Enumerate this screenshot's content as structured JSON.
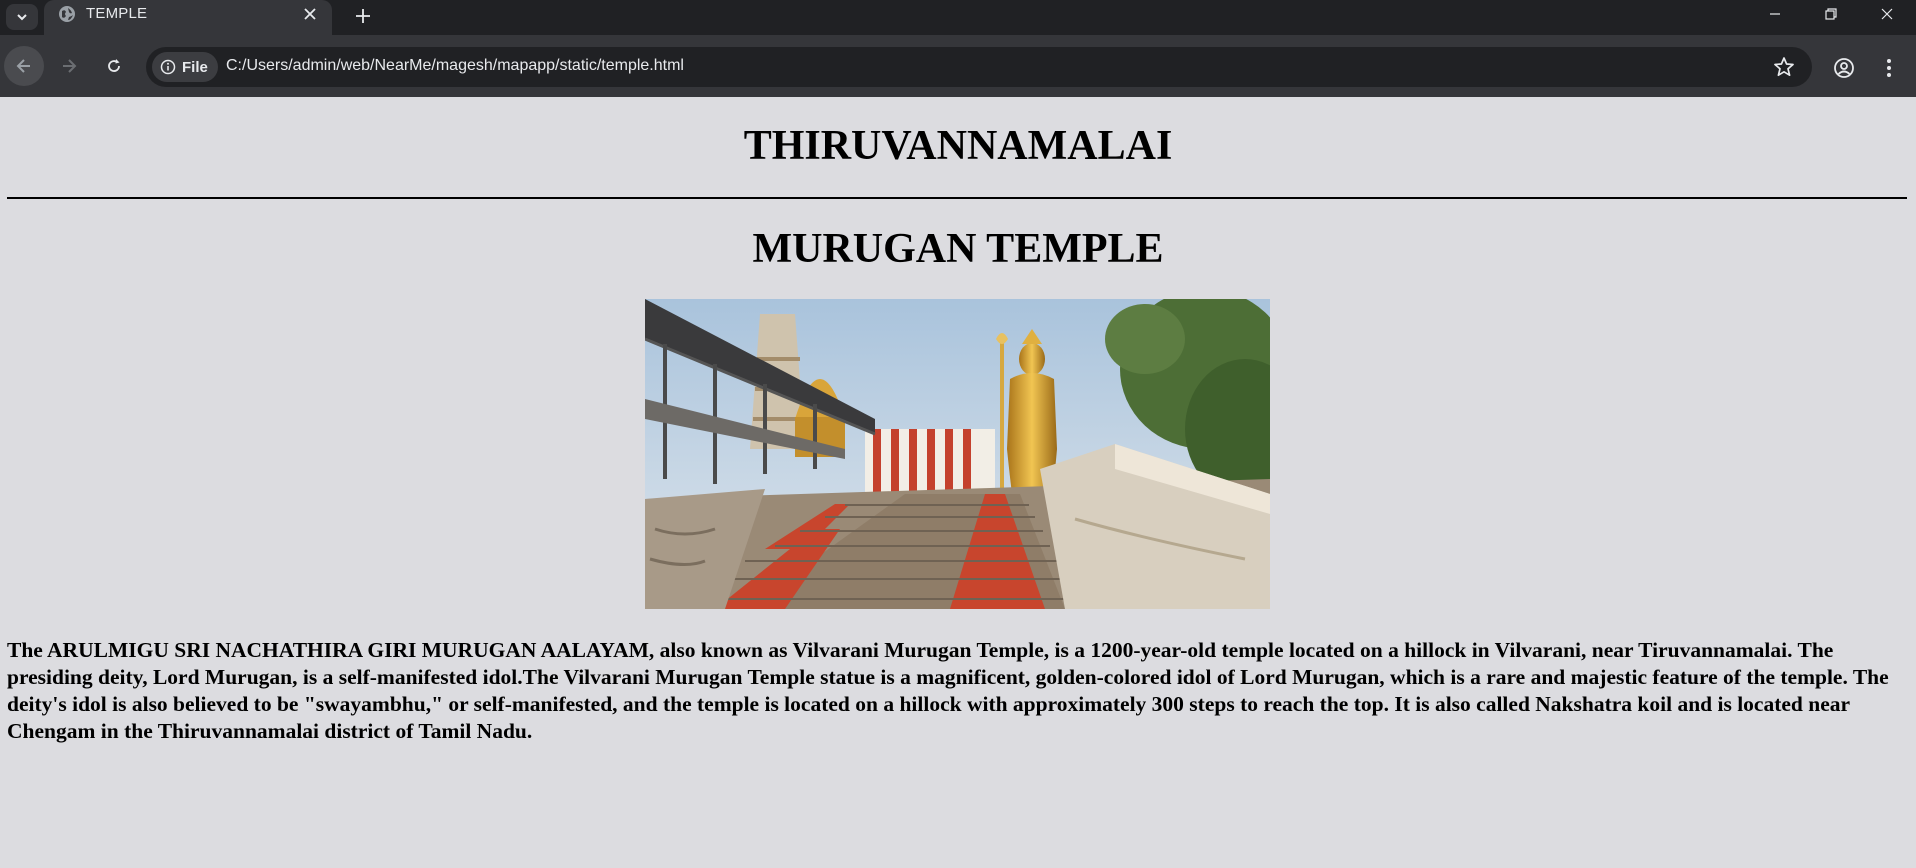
{
  "browser": {
    "tab_title": "TEMPLE",
    "site_chip": "File",
    "url": "C:/Users/admin/web/NearMe/magesh/mapapp/static/temple.html",
    "colors": {
      "frame": "#202124",
      "toolbar": "#35363a",
      "text": "#e8eaed"
    }
  },
  "page": {
    "heading": "THIRUVANNAMALAI",
    "subheading": "MURUGAN TEMPLE",
    "description": "The ARULMIGU SRI NACHATHIRA GIRI MURUGAN AALAYAM, also known as Vilvarani Murugan Temple, is a 1200-year-old temple located on a hillock in Vilvarani, near Tiruvannamalai. The presiding deity, Lord Murugan, is a self-manifested idol.The Vilvarani Murugan Temple statue is a magnificent, golden-colored idol of Lord Murugan, which is a rare and majestic feature of the temple. The deity's idol is also believed to be \"swayambhu,\" or self-manifested, and the temple is located on a hillock with approximately 300 steps to reach the top. It is also called Nakshatra koil and is located near Chengam in the Thiruvannamalai district of Tamil Nadu.",
    "background": "#dcdce0"
  },
  "icons": [
    "tab-search-icon",
    "globe-icon",
    "close-icon",
    "plus-icon",
    "minimize-icon",
    "restore-icon",
    "window-close-icon",
    "back-arrow-icon",
    "forward-arrow-icon",
    "reload-icon",
    "info-icon",
    "star-icon",
    "profile-icon",
    "menu-dots-icon"
  ]
}
